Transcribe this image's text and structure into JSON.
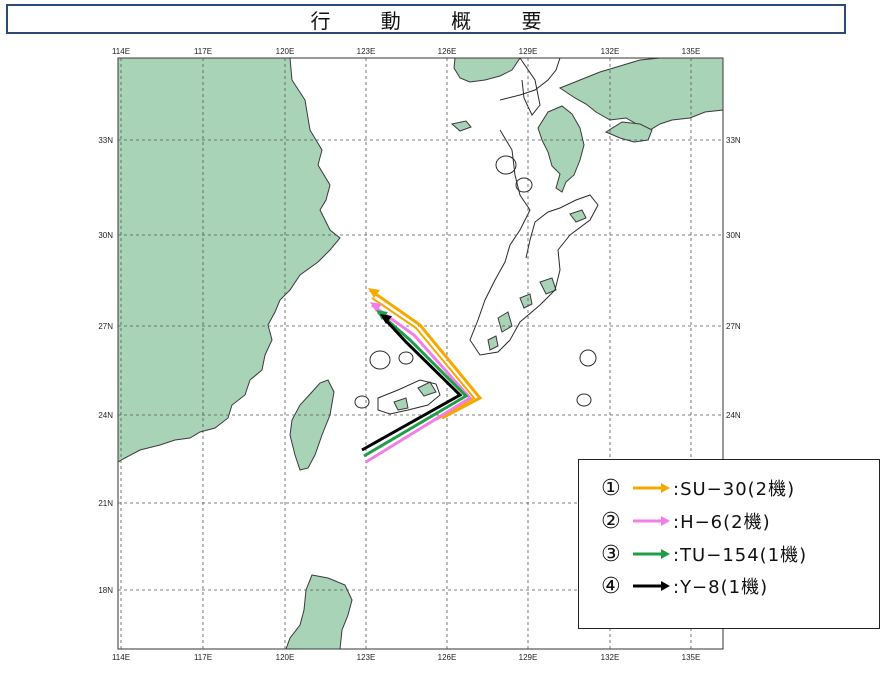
{
  "title": "行 動 概 要",
  "map": {
    "lon_labels": [
      "114E",
      "117E",
      "120E",
      "123E",
      "126E",
      "129E",
      "132E",
      "135E"
    ],
    "lat_labels": [
      "33N",
      "30N",
      "27N",
      "24N",
      "21N",
      "18N"
    ],
    "colors": {
      "land": "#a9d3b7",
      "coast": "#3a3a3a",
      "grid": "#555555",
      "water": "#ffffff"
    }
  },
  "legend": [
    {
      "num": "①",
      "label": ":SU−30(2機)",
      "color": "#f5a800"
    },
    {
      "num": "②",
      "label": ":H−6(2機)",
      "color": "#f47ee8"
    },
    {
      "num": "③",
      "label": ":TU−154(1機)",
      "color": "#1f9e4a"
    },
    {
      "num": "④",
      "label": ":Y−8(1機)",
      "color": "#000000"
    }
  ]
}
